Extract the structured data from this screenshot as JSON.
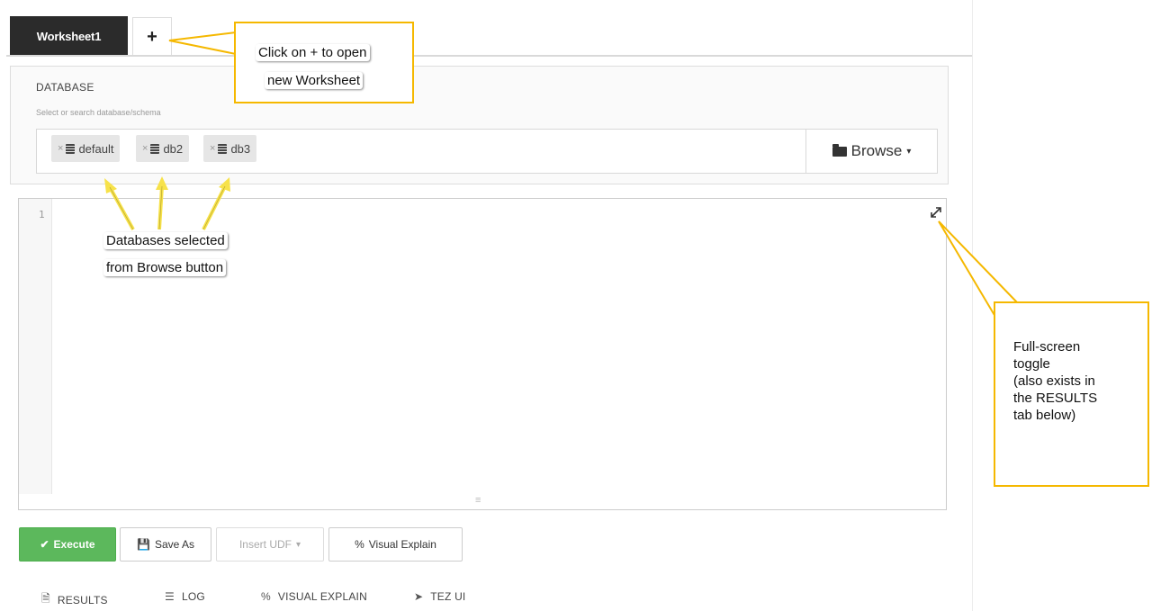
{
  "worksheet_tabs": [
    {
      "label": "Worksheet1"
    },
    {
      "label": "+"
    }
  ],
  "database": {
    "label": "DATABASE",
    "hint": "Select or search database/schema",
    "selected": [
      "default",
      "db2",
      "db3"
    ],
    "remove_glyph": "×",
    "browse_label": "Browse"
  },
  "editor": {
    "line_numbers": [
      "1"
    ],
    "resize_grip": "≡"
  },
  "toolbar": {
    "execute": "Execute",
    "save_as": "Save As",
    "insert_udf": "Insert UDF",
    "visual_explain": "Visual Explain"
  },
  "bottom_tabs": [
    "RESULTS",
    "LOG",
    "VISUAL EXPLAIN",
    "TEZ UI"
  ],
  "annotations": {
    "plus_callout_line1": "Click on + to open",
    "plus_callout_line2": "new Worksheet",
    "db_callout_line1": "Databases selected",
    "db_callout_line2": "from Browse button",
    "fullscreen_callout": [
      "Full-screen",
      "toggle",
      "(also exists in",
      "the RESULTS",
      "tab below)"
    ]
  },
  "colors": {
    "active_tab": "#2b2b2b",
    "execute": "#5cb85c",
    "annotation_border": "#f5b800",
    "arrow": "#f7e24a"
  },
  "icons": {
    "database": "database-icon",
    "folder": "folder-icon",
    "fullscreen": "expand-icon",
    "execute": "check-icon",
    "save": "floppy-icon",
    "visual_explain": "link-icon",
    "results": "document-icon",
    "log": "list-icon",
    "tez": "paper-plane-icon"
  }
}
